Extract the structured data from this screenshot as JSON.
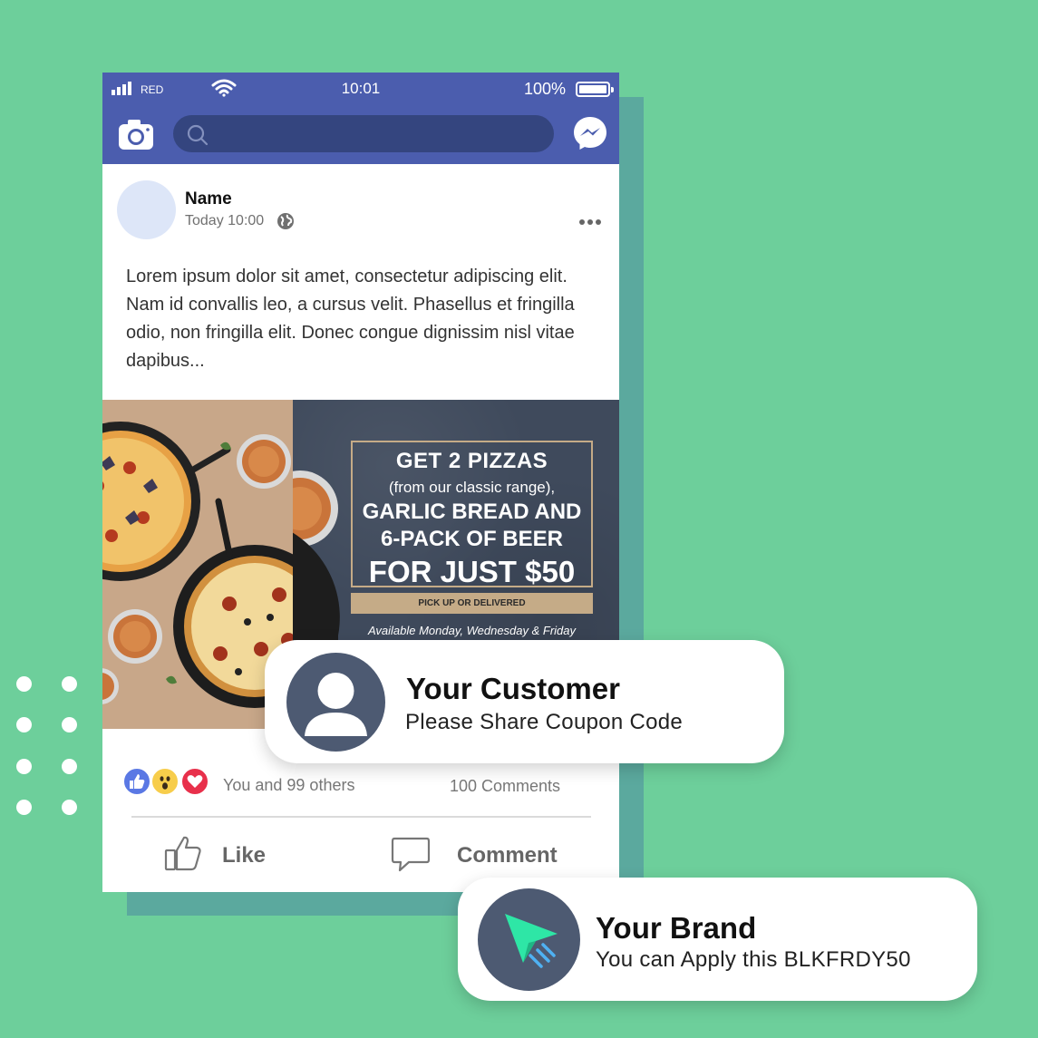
{
  "status_bar": {
    "carrier": "RED",
    "time": "10:01",
    "battery": "100%"
  },
  "navbar": {
    "search_placeholder": "",
    "icons": [
      "camera-icon",
      "search-icon",
      "messenger-icon"
    ]
  },
  "post": {
    "author": "Name",
    "timestamp": "Today 10:00",
    "text": "Lorem ipsum dolor sit amet, consectetur adipiscing elit. Nam id convallis leo, a cursus velit. Phasellus et fringilla odio, non fringilla elit. Donec congue dignissim nisl vitae dapibus...",
    "ad": {
      "line1": "GET 2 PIZZAS",
      "line2": "(from our classic range),",
      "line3": "GARLIC BREAD AND",
      "line4": "6-PACK OF BEER",
      "line5": "FOR JUST $50",
      "band": "PICK UP OR DELIVERED",
      "availability": "Available Monday, Wednesday & Friday"
    },
    "reactions_text": "You and 99 others",
    "comments_count": "100 Comments",
    "actions": {
      "like": "Like",
      "comment": "Comment"
    }
  },
  "customer_card": {
    "title": "Your Customer",
    "subtitle": "Please Share Coupon Code"
  },
  "brand_card": {
    "title": "Your Brand",
    "subtitle": "You can Apply this BLKFRDY50"
  },
  "colors": {
    "background": "#6dcf9b",
    "navbar": "#4b5dae",
    "search": "#34457f",
    "avatar_dark": "#4d5a72",
    "brand_green": "#2ee6a6"
  }
}
